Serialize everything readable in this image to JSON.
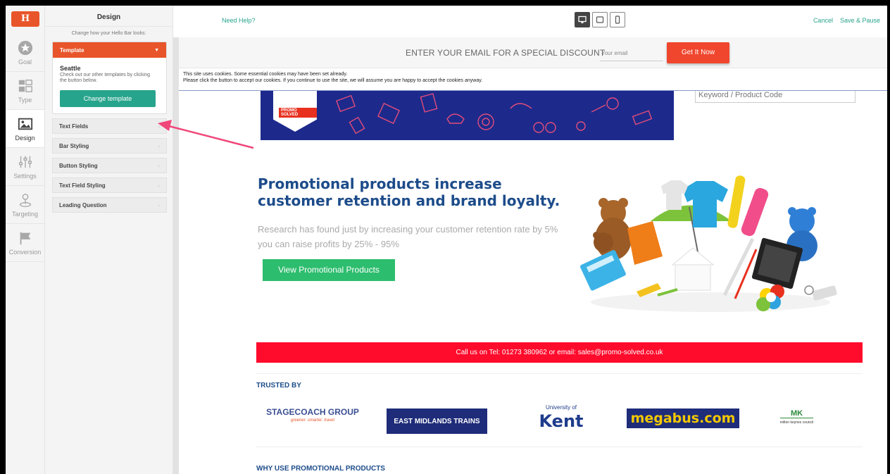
{
  "app": {
    "logo_text": "H",
    "need_help": "Need Help?",
    "cancel": "Cancel",
    "save_pause": "Save & Pause"
  },
  "rail": {
    "items": [
      {
        "label": "Goal",
        "icon": "star-icon"
      },
      {
        "label": "Type",
        "icon": "layout-icon"
      },
      {
        "label": "Design",
        "icon": "image-icon"
      },
      {
        "label": "Settings",
        "icon": "sliders-icon"
      },
      {
        "label": "Targeting",
        "icon": "target-pin-icon"
      },
      {
        "label": "Conversion",
        "icon": "flag-icon"
      }
    ],
    "active": "Design"
  },
  "panel": {
    "title": "Design",
    "subtitle": "Change how your Hello Bar looks:",
    "template": {
      "header": "Template",
      "name": "Seattle",
      "description": "Check out our other templates by clicking the button below.",
      "button": "Change template"
    },
    "sections": [
      "Text Fields",
      "Bar Styling",
      "Button Styling",
      "Text Field Styling",
      "Leading Question"
    ]
  },
  "devices": [
    "desktop-icon",
    "tablet-icon",
    "mobile-icon"
  ],
  "preview": {
    "hellobar": {
      "text": "ENTER YOUR EMAIL FOR A SPECIAL DISCOUNT",
      "placeholder": "Your email",
      "button": "Get It Now"
    },
    "cookie_line1": "This site uses cookies. Some essential cookies may have been set already.",
    "cookie_line2": "Please click the button to accept our cookies. If you continue to use the site, we will assume you are happy to accept the cookies anyway.",
    "banner_brand": "PROMO SOLVED",
    "search_placeholder": "Keyword / Product Code",
    "headline": "Promotional products increase customer retention and brand loyalty.",
    "subtext": "Research has found just by increasing your customer retention rate by 5% you can raise profits by 25% - 95%",
    "cta": "View Promotional Products",
    "call_bar": "Call us on Tel: 01273 380962 or email: sales@promo-solved.co.uk",
    "trusted_by": "TRUSTED BY",
    "logos": {
      "stagecoach": "STAGECOACH GROUP",
      "stagecoach_tag": "greener. smarter. travel",
      "east_midlands": "EAST MIDLANDS TRAINS",
      "kent_small": "University of",
      "kent": "Kent",
      "megabus": "megabus.com",
      "mk": "MK",
      "mk_small": "milton keynes council"
    },
    "why": "WHY USE PROMOTIONAL PRODUCTS"
  },
  "colors": {
    "accent": "#e8552a",
    "teal": "#27a48c",
    "cta_green": "#2dbd6e",
    "call_red": "#ff0b2c",
    "navy": "#1d4c8a",
    "arrow": "#f0477a"
  }
}
